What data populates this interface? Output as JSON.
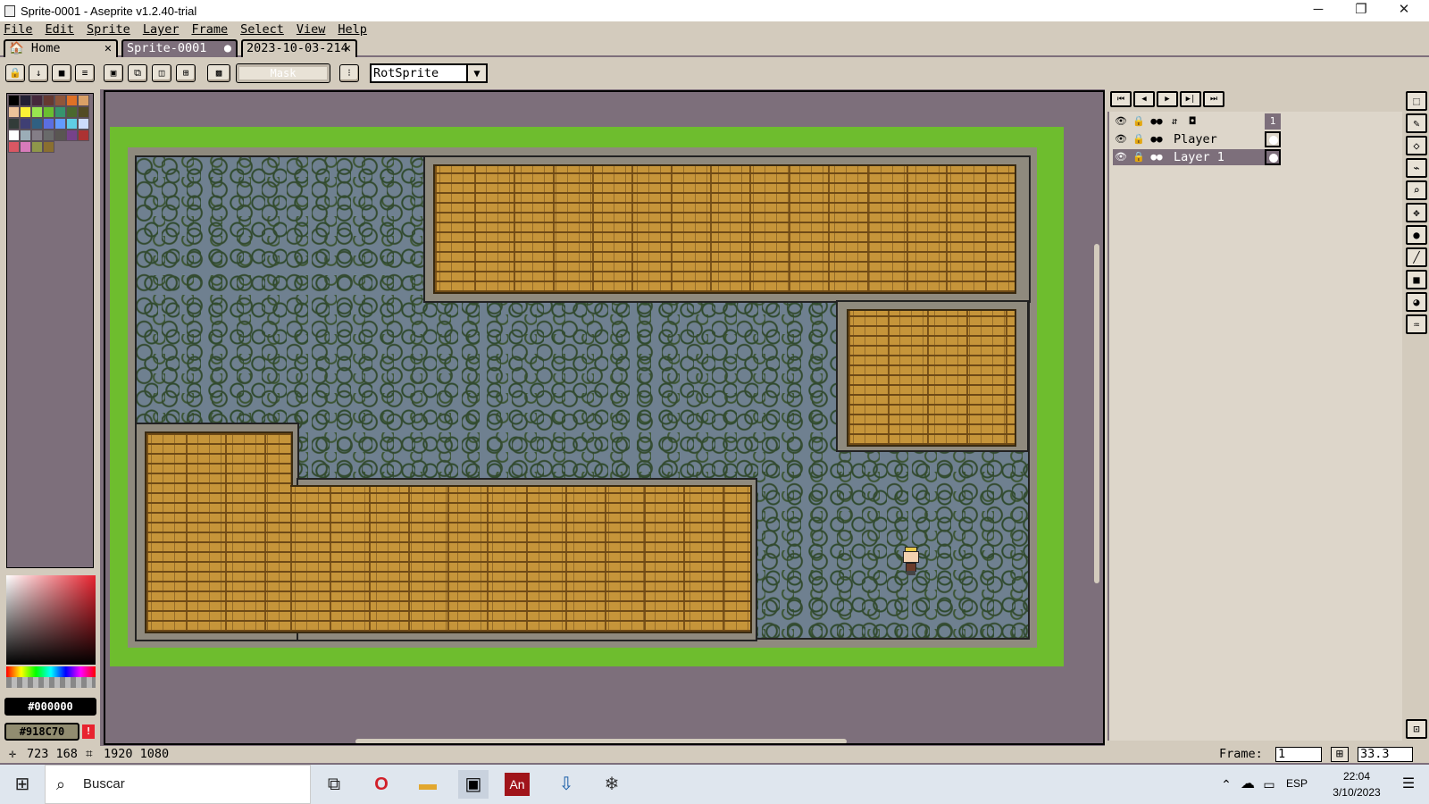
{
  "window": {
    "title": "Sprite-0001 - Aseprite v1.2.40-trial",
    "controls": [
      "─",
      "❐",
      "✕"
    ]
  },
  "menu": [
    "File",
    "Edit",
    "Sprite",
    "Layer",
    "Frame",
    "Select",
    "View",
    "Help"
  ],
  "tabs": [
    {
      "label": "🏠 Home",
      "close": "✕"
    },
    {
      "label": "Sprite-0001",
      "close": "●"
    },
    {
      "label": "2023-10-03-214",
      "close": "✕"
    }
  ],
  "toolbar": {
    "mask_label": "Mask",
    "rotation_algorithm": "RotSprite",
    "dropdown": "▼"
  },
  "palette_colors": [
    "#000000",
    "#222034",
    "#45283c",
    "#663931",
    "#8f563b",
    "#df7126",
    "#d9a066",
    "#eec39a",
    "#fbf236",
    "#99e550",
    "#6abe30",
    "#37946e",
    "#4b692f",
    "#524b24",
    "#323c39",
    "#3f3f74",
    "#306082",
    "#5b6ee1",
    "#639bff",
    "#5fcde4",
    "#cbdbfc",
    "#ffffff",
    "#9badb7",
    "#847e87",
    "#696a6a",
    "#595652",
    "#76428a",
    "#ac3232",
    "#d95763",
    "#d77bba",
    "#8f974a",
    "#8a6f30"
  ],
  "colors": {
    "foreground_hex": "#000000",
    "background_hex": "#918C70",
    "fg": "#000000",
    "bg": "#918c70",
    "warning": "!"
  },
  "timeline": {
    "frame_number": "1",
    "layers": [
      {
        "name": "Player"
      },
      {
        "name": "Layer 1"
      }
    ]
  },
  "status": {
    "cursor": "723  168",
    "size": "1920  1080",
    "frame_label": "Frame:",
    "frame_value": "1",
    "zoom": "33.3"
  },
  "taskbar": {
    "search_placeholder": "Buscar",
    "language": "ESP",
    "time": "22:04",
    "date": "3/10/2023"
  }
}
